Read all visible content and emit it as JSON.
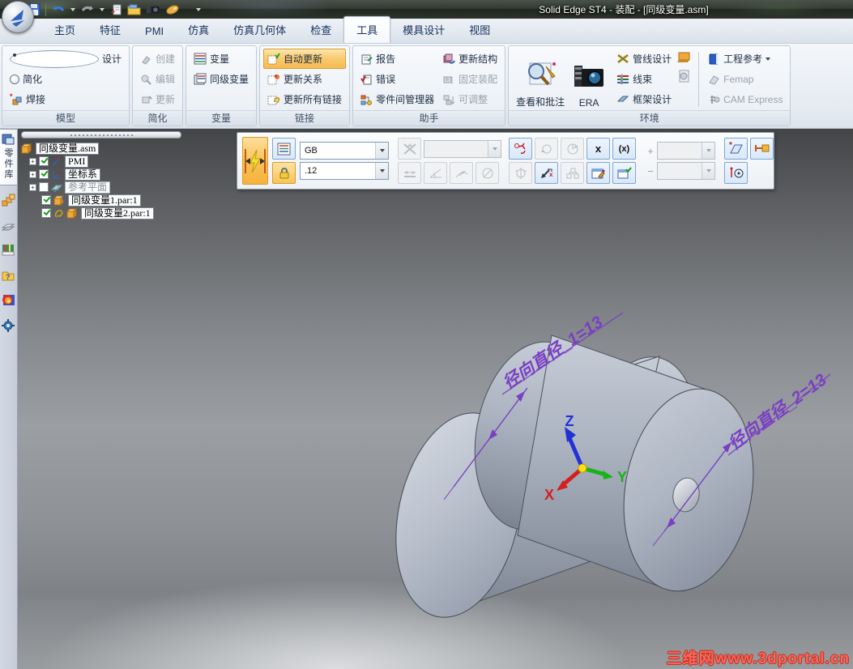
{
  "app": {
    "title": "Solid Edge ST4 - 装配 - [同级变量.asm]"
  },
  "tabs": {
    "items": [
      {
        "label": "主页"
      },
      {
        "label": "特征"
      },
      {
        "label": "PMI"
      },
      {
        "label": "仿真"
      },
      {
        "label": "仿真几何体"
      },
      {
        "label": "检查"
      },
      {
        "label": "工具"
      },
      {
        "label": "模具设计"
      },
      {
        "label": "视图"
      }
    ]
  },
  "ribbon": {
    "model": {
      "label": "模型",
      "design": "设计",
      "simplify": "简化",
      "weld": "焊接"
    },
    "simplify": {
      "label": "简化",
      "create": "创建",
      "edit": "编辑",
      "update": "更新"
    },
    "variables": {
      "label": "变量",
      "variables": "变量",
      "peer": "同级变量"
    },
    "links": {
      "label": "链接",
      "auto": "自动更新",
      "relations": "更新关系",
      "all": "更新所有链接"
    },
    "assist": {
      "label": "助手",
      "report": "报告",
      "errors": "错误",
      "manager": "零件间管理器",
      "structure": "更新结构",
      "fixed": "固定装配",
      "adjustable": "可调整"
    },
    "environ": {
      "label": "环境",
      "review": "查看和批注",
      "era": "ERA",
      "piping": "管线设计",
      "harness": "线束",
      "frame": "框架设计",
      "engref": "工程参考",
      "femap": "Femap",
      "cam": "CAM Express"
    }
  },
  "commandbar": {
    "style_value": "GB",
    "round_value": ".12",
    "x_label": "x",
    "fx_label": "(x)",
    "plus": "+",
    "minus": "−"
  },
  "edgebar": {
    "library_tab": "零件库"
  },
  "tree": {
    "root": "同级变量.asm",
    "pmi": "PMI",
    "csys": "坐标系",
    "refplanes": "参考平面",
    "part1": "同级变量1.par:1",
    "part2": "同级变量2.par:1"
  },
  "scene": {
    "dim1": "径向直径_1=13",
    "dim2": "径向直径_2=13",
    "axis_x": "X",
    "axis_y": "Y",
    "axis_z": "Z",
    "watermark": "三维网www.3dportal.cn",
    "dim_color": "#7a3fc4"
  }
}
